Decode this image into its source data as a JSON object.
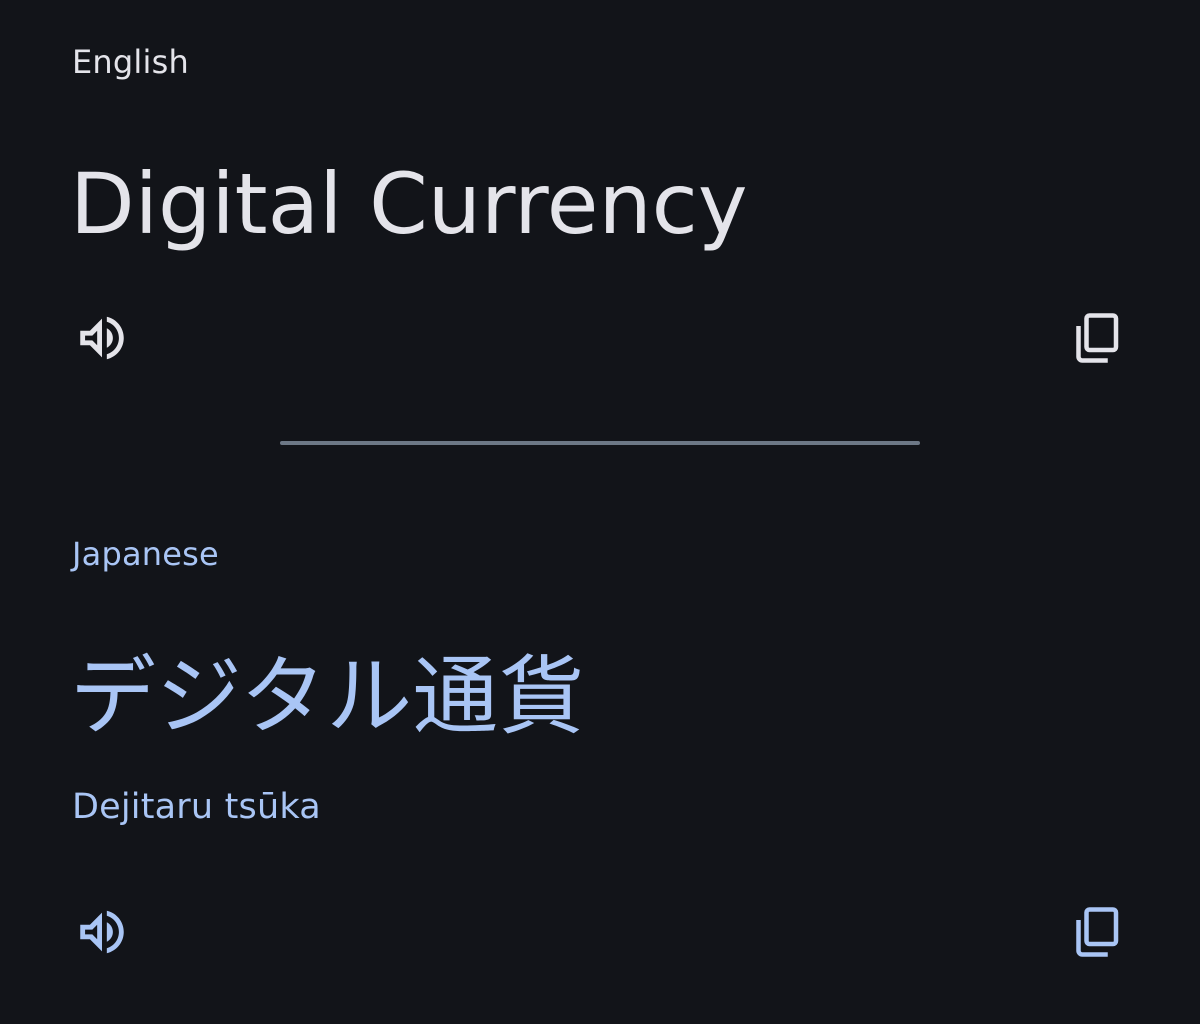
{
  "colors": {
    "background": "#121419",
    "source_text": "#e4e4ea",
    "target_text": "#a9c5f5",
    "divider": "#6d7886"
  },
  "source": {
    "language_label": "English",
    "text": "Digital Currency",
    "speaker_icon": "volume-icon",
    "copy_icon": "copy-icon"
  },
  "target": {
    "language_label": "Japanese",
    "text": "デジタル通貨",
    "transliteration": "Dejitaru tsūka",
    "speaker_icon": "volume-icon",
    "copy_icon": "copy-icon"
  }
}
